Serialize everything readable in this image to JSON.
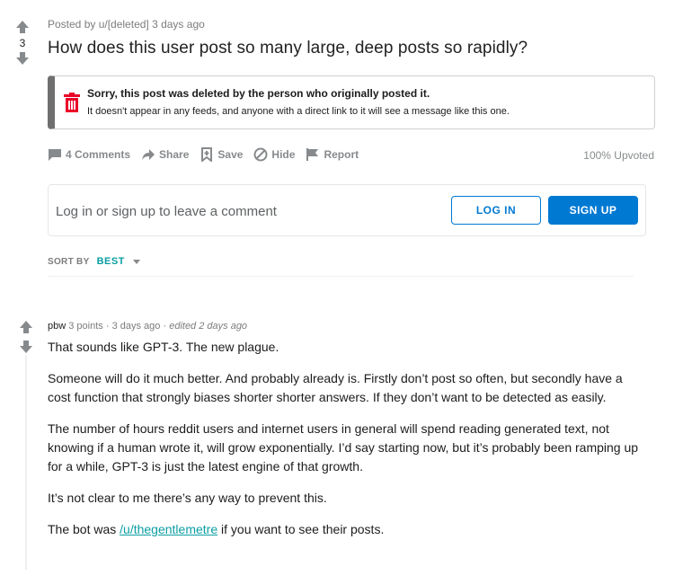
{
  "post": {
    "score": "3",
    "meta": "Posted by u/[deleted] 3 days ago",
    "title": "How does this user post so many large, deep posts so rapidly?",
    "deleted_notice": {
      "title": "Sorry, this post was deleted by the person who originally posted it.",
      "subtitle": "It doesn't appear in any feeds, and anyone with a direct link to it will see a message like this one."
    },
    "actions": {
      "comments": "4 Comments",
      "share": "Share",
      "save": "Save",
      "hide": "Hide",
      "report": "Report"
    },
    "upvoted": "100% Upvoted"
  },
  "login_prompt": {
    "text": "Log in or sign up to leave a comment",
    "login_label": "LOG IN",
    "signup_label": "SIGN UP"
  },
  "sort": {
    "label": "SORT BY",
    "value": "BEST"
  },
  "comment": {
    "author": "pbw",
    "points": "3 points",
    "age": "3 days ago",
    "edited": "edited 2 days ago",
    "paragraphs": [
      "That sounds like GPT-3. The new plague.",
      "Someone will do it much better. And probably already is. Firstly don’t post so often, but secondly have a cost function that strongly biases shorter shorter answers. If they don’t want to be detected as easily.",
      "The number of hours reddit users and internet users in general will spend reading generated text, not knowing if a human wrote it, will grow exponentially. I’d say starting now, but it’s probably been ramping up for a while, GPT-3 is just the latest engine of that growth.",
      "It’s not clear to me there’s any way to prevent this."
    ],
    "last_paragraph": {
      "prefix": "The bot was ",
      "link_text": "/u/thegentlemetre",
      "suffix": " if you want to see their posts."
    }
  },
  "colors": {
    "accent_blue": "#0079d3",
    "teal": "#0b9ea2",
    "deleted_red": "#ea0027",
    "muted": "#878a8c"
  }
}
